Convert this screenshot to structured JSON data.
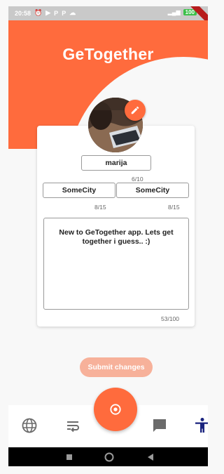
{
  "status_bar": {
    "time": "20:58",
    "left_icons": [
      "alarm-icon",
      "play-icon",
      "p-icon",
      "p-icon",
      "cloud-icon"
    ],
    "signal": "signal-icon",
    "battery_level": "100"
  },
  "app": {
    "title": "GeTogether"
  },
  "profile": {
    "username": "marija",
    "username_counter": "6/10",
    "city_one": "SomeCity",
    "city_one_counter": "8/15",
    "city_two": "SomeCity",
    "city_two_counter": "8/15",
    "bio": "New to GeTogether app. Lets get together i guess.. :)",
    "bio_counter": "53/100"
  },
  "actions": {
    "submit_label": "Submit changes"
  },
  "colors": {
    "accent": "#ff6b3d",
    "submit_disabled": "#f7b19a",
    "nav_active": "#1a237e"
  },
  "bottom_nav": {
    "items": [
      "globe-icon",
      "wrap-text-icon",
      "target-icon",
      "chat-icon",
      "accessibility-icon"
    ],
    "active": "accessibility-icon"
  },
  "system_nav": [
    "square-icon",
    "circle-icon",
    "triangle-back-icon"
  ]
}
